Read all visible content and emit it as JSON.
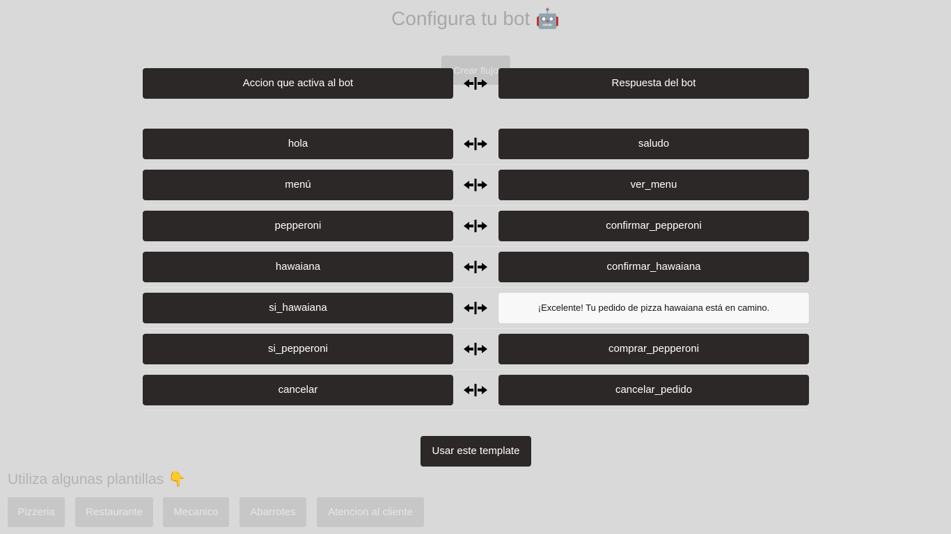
{
  "header": {
    "title": "Configura tu bot 🤖",
    "create_flow_label": "Crear flujo"
  },
  "columns": {
    "trigger_header": "Accion que activa al bot",
    "response_header": "Respuesta del bot"
  },
  "rows": [
    {
      "trigger": "hola",
      "response": "saludo"
    },
    {
      "trigger": "menú",
      "response": "ver_menu"
    },
    {
      "trigger": "pepperoni",
      "response": "confirmar_pepperoni"
    },
    {
      "trigger": "hawaiana",
      "response": "confirmar_hawaiana"
    },
    {
      "trigger": "si_hawaiana",
      "response": "¡Excelente! Tu pedido de pizza hawaiana está en camino."
    },
    {
      "trigger": "si_pepperoni",
      "response": "comprar_pepperoni"
    },
    {
      "trigger": "cancelar",
      "response": "cancelar_pedido"
    }
  ],
  "actions": {
    "use_template_label": "Usar este template"
  },
  "templates": {
    "title": "Utiliza algunas plantillas 👇",
    "items": [
      "Pizzeria",
      "Restaurante",
      "Mecanico",
      "Abarrotes",
      "Atencion al cliente"
    ]
  },
  "colors": {
    "background": "#d9d9d9",
    "dark_cell": "#2b2827",
    "light_cell": "#f8f8f8",
    "muted_button": "#c7c7c7"
  },
  "icons": {
    "connector": "bidirectional-arrow-icon"
  }
}
